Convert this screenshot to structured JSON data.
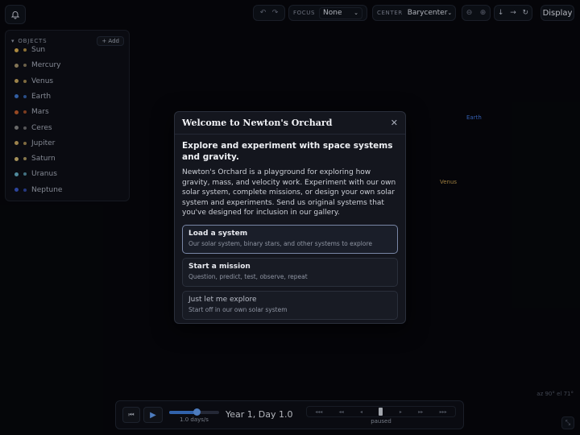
{
  "toolbar": {
    "focus_label": "FOCUS",
    "focus_value": "None",
    "center_label": "CENTER",
    "center_value": "Barycenter",
    "display_label": "Display"
  },
  "objects_panel": {
    "title": "OBJECTS",
    "add_label": "+ Add",
    "items": [
      {
        "name": "Sun",
        "color": "#c9a14a"
      },
      {
        "name": "Mercury",
        "color": "#9a8a66"
      },
      {
        "name": "Venus",
        "color": "#b89a58"
      },
      {
        "name": "Earth",
        "color": "#3b6fc0"
      },
      {
        "name": "Mars",
        "color": "#b3562a"
      },
      {
        "name": "Ceres",
        "color": "#7d7d7d"
      },
      {
        "name": "Jupiter",
        "color": "#b99a5a"
      },
      {
        "name": "Saturn",
        "color": "#c2ab6a"
      },
      {
        "name": "Uranus",
        "color": "#5fa3b8"
      },
      {
        "name": "Neptune",
        "color": "#3450b8"
      }
    ]
  },
  "canvas": {
    "earth_label": "Earth",
    "venus_label": "Venus",
    "coords": "az 90°  el 71°"
  },
  "modal": {
    "title": "Welcome to Newton's Orchard",
    "heading": "Explore and experiment with space systems and gravity.",
    "paragraph": "Newton's Orchard is a playground for exploring how gravity, mass, and velocity work. Experiment with our own solar system, complete missions, or design your own solar system and experiments. Send us original systems that you've designed for inclusion in our gallery.",
    "options": [
      {
        "title": "Load a system",
        "subtitle": "Our solar system, binary stars, and other systems to explore"
      },
      {
        "title": "Start a mission",
        "subtitle": "Question, predict, test, observe, repeat"
      },
      {
        "title": "Just let me explore",
        "subtitle": "Start off in our own solar system"
      }
    ]
  },
  "timebar": {
    "days_label": "1.0 days/s",
    "date": "Year 1, Day 1.0",
    "status": "paused",
    "speed_glyphs": [
      "◂◂◂",
      "◂◂",
      "◂",
      "▸",
      "▸▸",
      "▸▸▸"
    ]
  },
  "colors": {
    "accent": "#3a74c9",
    "earth_label": "#3d6fd0",
    "venus_label": "#b8934a"
  }
}
